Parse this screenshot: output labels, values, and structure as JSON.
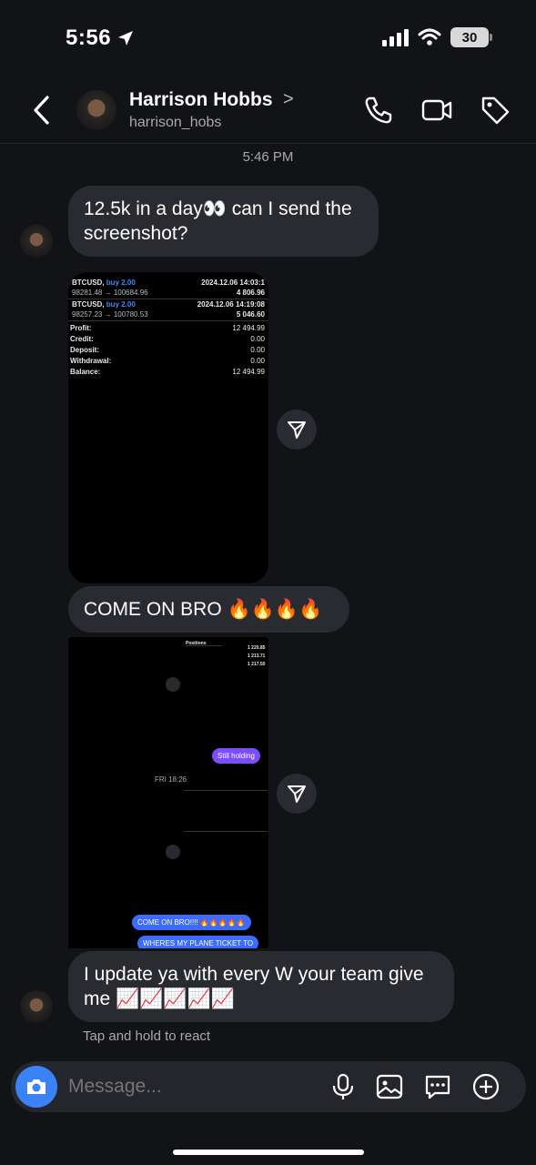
{
  "status": {
    "time": "5:56",
    "battery": "30"
  },
  "header": {
    "name": "Harrison Hobbs",
    "username": "harrison_hobs",
    "chevron": ">"
  },
  "thread": {
    "timestamp": "5:46 PM",
    "msg1": "12.5k in a day👀 can I send the screenshot?",
    "msg2": "COME ON BRO 🔥🔥🔥🔥",
    "msg3": "I update ya with every W your team give me 📈📈📈📈📈",
    "react_hint": "Tap and hold to react"
  },
  "screenshot1": {
    "t1_symbol": "BTCUSD,",
    "t1_side": "buy 2.00",
    "t1_date": "2024.12.06 14:03:1",
    "t1_prices": "98281.48 → 100684.96",
    "t1_profit": "4 806.96",
    "t2_symbol": "BTCUSD,",
    "t2_side": "buy 2.00",
    "t2_date": "2024.12.06 14:19:08",
    "t2_prices": "98257.23 → 100780.53",
    "t2_profit": "5 046.60",
    "summary": [
      {
        "label": "Profit:",
        "value": "12 494.99"
      },
      {
        "label": "Credit:",
        "value": "0.00"
      },
      {
        "label": "Deposit:",
        "value": "0.00"
      },
      {
        "label": "Withdrawal:",
        "value": "0.00"
      },
      {
        "label": "Balance:",
        "value": "12 494.99"
      }
    ]
  },
  "screenshot2": {
    "header": "Positions",
    "v1": "1 220.85",
    "v2": "1 213.71",
    "v3": "1 217.50",
    "bubble1": "Still holding",
    "day": "FRI 18:26",
    "bubble2": "COME ON BRO!!!! 🔥🔥🔥🔥🔥",
    "bubble3": "WHERES MY PLANE TICKET TO"
  },
  "composer": {
    "placeholder": "Message..."
  },
  "colors": {
    "accent": "#3b82f6",
    "bubble": "#2a2b31",
    "background": "#121317",
    "profit_blue": "#3d8bff",
    "mini_purple": "#7b4dff"
  }
}
